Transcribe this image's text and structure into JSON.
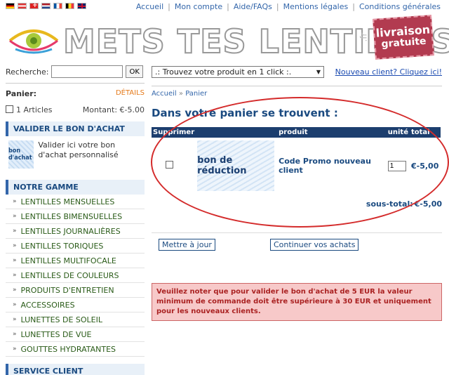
{
  "flags": [
    "de",
    "at",
    "ch",
    "nl",
    "fr",
    "be",
    "uk"
  ],
  "topnav": [
    "Accueil",
    "Mon compte",
    "Aide/FAQs",
    "Mentions légales",
    "Conditions générales"
  ],
  "logo": {
    "text": "METS TES LENTILLES",
    "tld": ".fr",
    "stamp_line1": "livraison",
    "stamp_line2": "gratuite"
  },
  "search": {
    "label": "Recherche:",
    "value": "",
    "button": "OK"
  },
  "cart_summary": {
    "label": "Panier:",
    "details": "DÉTAILS",
    "count": "1 Articles",
    "amount": "Montant: €-5.00"
  },
  "voucher_box": {
    "title": "VALIDER LE BON D'ACHAT",
    "image_text": "bon d'achat",
    "text": "Valider ici votre bon d'achat personnalisé"
  },
  "range_box": {
    "title": "NOTRE GAMME",
    "items": [
      "LENTILLES MENSUELLES",
      "LENTILLES BIMENSUELLES",
      "LENTILLES JOURNALIÈRES",
      "LENTILLES TORIQUES",
      "LENTILLES MULTIFOCALE",
      "LENTILLES DE COULEURS",
      "PRODUITS D'ENTRETIEN",
      "ACCESSOIRES",
      "LUNETTES DE SOLEIL",
      "LUNETTES DE VUE",
      "GOUTTES HYDRATANTES"
    ]
  },
  "service_box": {
    "title": "SERVICE CLIENT"
  },
  "product_select": {
    "value": ".: Trouvez votre produit en 1 click :."
  },
  "new_client": "Nouveau client? Cliquez ici!",
  "breadcrumb": [
    "Accueil",
    "Panier"
  ],
  "heading": "Dans votre panier se trouvent :",
  "table": {
    "headers": [
      "Supprimer",
      "produit",
      "unité",
      "total"
    ],
    "row": {
      "image_text": "bon de réduction",
      "name": "Code Promo nouveau client",
      "qty": "1",
      "total": "€-5,00"
    },
    "subtotal_label": "sous-total:",
    "subtotal_value": "€-5,00"
  },
  "buttons": {
    "update": "Mettre à jour",
    "continue": "Continuer vos achats"
  },
  "notice": "Veuillez noter que pour valider le bon d'achat de 5 EUR la valeur minimum de commande doit être supérieure à 30 EUR et uniquement pour les nouveaux clients.",
  "colors": {
    "accent": "#1a4a80",
    "annotation": "#d42b2b",
    "notice_bg": "#f7c9c9"
  }
}
